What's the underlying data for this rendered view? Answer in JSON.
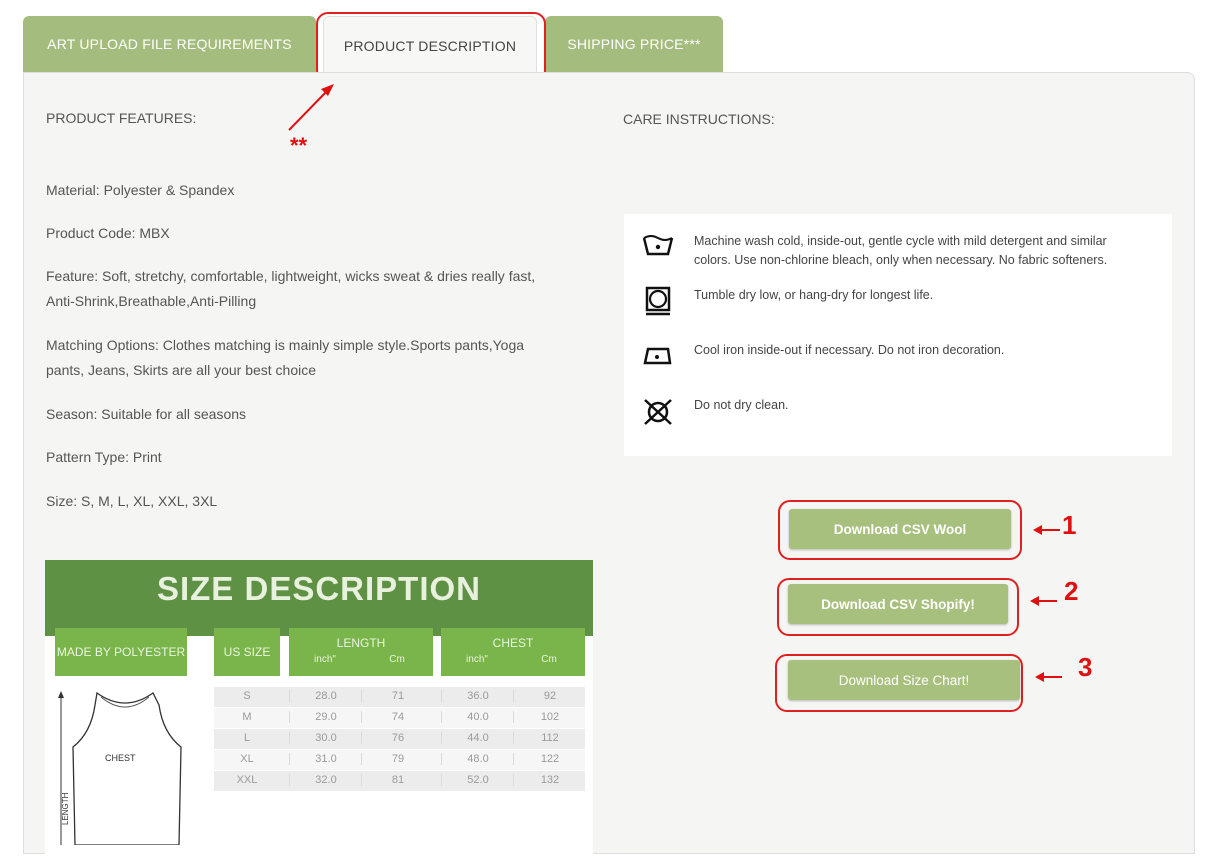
{
  "tabs": [
    {
      "label": "ART UPLOAD FILE REQUIREMENTS"
    },
    {
      "label": "PRODUCT DESCRIPTION"
    },
    {
      "label": "SHIPPING PRICE***"
    }
  ],
  "annotations": {
    "tab_marker": "**",
    "btn1": "1",
    "btn2": "2",
    "btn3": "3"
  },
  "features": {
    "heading": "PRODUCT FEATURES:",
    "material": "Material: Polyester & Spandex",
    "code": "Product Code: MBX",
    "feature_line1": "Feature: Soft, stretchy,  comfortable,  lightweight, wicks sweat & dries really fast,",
    "feature_line2": "Anti-Shrink,Breathable,Anti-Pilling",
    "matching_line1": "Matching Options: Clothes matching is mainly simple style.Sports pants,Yoga",
    "matching_line2": "pants, Jeans, Skirts are all your best choice",
    "season": "Season: Suitable for all seasons",
    "pattern": "Pattern Type: Print",
    "size": "Size: S, M, L, XL, XXL, 3XL"
  },
  "care": {
    "heading": "CARE INSTRUCTIONS:",
    "wash_line1": "Machine wash cold, inside-out, gentle cycle with mild detergent and similar",
    "wash_line2": "colors. Use non-chlorine bleach, only when necessary. No fabric softeners.",
    "dry": "Tumble dry low, or hang-dry for longest life.",
    "iron": "Cool iron inside-out if necessary. Do not iron decoration.",
    "clean": "Do not dry clean."
  },
  "buttons": {
    "csv_wool": "Download CSV Wool",
    "csv_shopify": "Download CSV Shopify!",
    "size_chart": "Download Size Chart!"
  },
  "size_chart": {
    "title": "SIZE DESCRIPTION",
    "made_by": "MADE BY POLYESTER",
    "us_size": "US SIZE",
    "length": "LENGTH",
    "chest": "CHEST",
    "inch": "inch\"",
    "cm": "Cm",
    "chest_label": "CHEST",
    "length_label": "LENGTH",
    "rows": [
      {
        "size": "S",
        "len_in": "28.0",
        "len_cm": "71",
        "chest_in": "36.0",
        "chest_cm": "92"
      },
      {
        "size": "M",
        "len_in": "29.0",
        "len_cm": "74",
        "chest_in": "40.0",
        "chest_cm": "102"
      },
      {
        "size": "L",
        "len_in": "30.0",
        "len_cm": "76",
        "chest_in": "44.0",
        "chest_cm": "112"
      },
      {
        "size": "XL",
        "len_in": "31.0",
        "len_cm": "79",
        "chest_in": "48.0",
        "chest_cm": "122"
      },
      {
        "size": "XXL",
        "len_in": "32.0",
        "len_cm": "81",
        "chest_in": "52.0",
        "chest_cm": "132"
      }
    ]
  }
}
